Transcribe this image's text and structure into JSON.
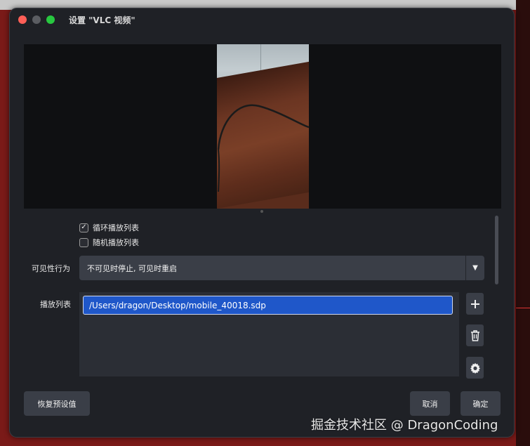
{
  "window": {
    "title": "设置 \"VLC 视频\""
  },
  "options": {
    "loop_label": "循环播放列表",
    "loop_checked": true,
    "shuffle_label": "随机播放列表",
    "shuffle_checked": false
  },
  "visibility": {
    "label": "可见性行为",
    "selected": "不可见时停止, 可见时重启"
  },
  "playlist": {
    "label": "播放列表",
    "items": [
      "/Users/dragon/Desktop/mobile_40018.sdp"
    ]
  },
  "icons": {
    "add": "plus-icon",
    "remove": "trash-icon",
    "settings": "gear-icon",
    "dropdown": "chevron-down-icon",
    "check": "checkmark-icon"
  },
  "buttons": {
    "restore_defaults": "恢复预设值",
    "cancel": "取消",
    "ok": "确定"
  },
  "watermark": "掘金技术社区 @ DragonCoding",
  "colors": {
    "window_bg": "#1f2126",
    "control_bg": "#3a3e47",
    "selection": "#1f57c9",
    "close": "#ff5f57",
    "maximize": "#28c840"
  }
}
